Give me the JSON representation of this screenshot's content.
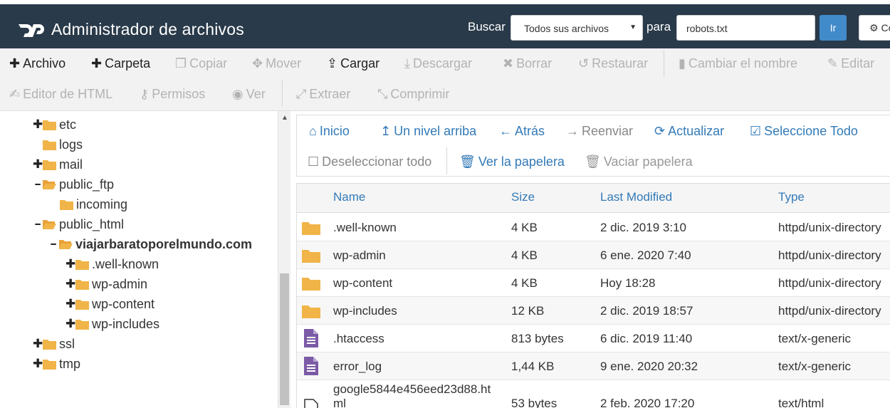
{
  "header": {
    "app_title": "Administrador de archivos",
    "search_label": "Buscar",
    "search_scope": "Todos sus archivos",
    "para_label": "para",
    "search_value": "robots.txt",
    "go_label": "Ir",
    "settings_label": "Co",
    "brand_color": "#293a4a"
  },
  "toolbar": {
    "row1": [
      {
        "label": "Archivo",
        "icon": "plus-icon",
        "enabled": true
      },
      {
        "label": "Carpeta",
        "icon": "plus-icon",
        "enabled": true
      },
      {
        "label": "Copiar",
        "icon": "copy-icon",
        "enabled": false
      },
      {
        "label": "Mover",
        "icon": "move-icon",
        "enabled": false
      },
      {
        "label": "Cargar",
        "icon": "upload-icon",
        "enabled": true
      },
      {
        "label": "Descargar",
        "icon": "download-icon",
        "enabled": false
      },
      {
        "label": "Borrar",
        "icon": "times-icon",
        "enabled": false
      },
      {
        "label": "Restaurar",
        "icon": "undo-icon",
        "enabled": false
      },
      {
        "label": "Cambiar el nombre",
        "icon": "file-icon",
        "enabled": false
      },
      {
        "label": "Editar",
        "icon": "pencil-icon",
        "enabled": false
      }
    ],
    "row2": [
      {
        "label": "Editor de HTML",
        "icon": "edit-icon",
        "enabled": false
      },
      {
        "label": "Permisos",
        "icon": "key-icon",
        "enabled": false
      },
      {
        "label": "Ver",
        "icon": "eye-icon",
        "enabled": false
      },
      {
        "label": "Extraer",
        "icon": "expand-icon",
        "enabled": false
      },
      {
        "label": "Comprimir",
        "icon": "compress-icon",
        "enabled": false
      }
    ]
  },
  "tree": {
    "nodes": [
      {
        "label": "etc",
        "toggle": "+"
      },
      {
        "label": "logs",
        "toggle": ""
      },
      {
        "label": "mail",
        "toggle": "+"
      },
      {
        "label": "public_ftp",
        "toggle": "−"
      },
      {
        "label": "incoming",
        "toggle": ""
      },
      {
        "label": "public_html",
        "toggle": "−"
      },
      {
        "label": "viajarbaratoporelmundo.com",
        "toggle": "−"
      },
      {
        "label": ".well-known",
        "toggle": "+"
      },
      {
        "label": "wp-admin",
        "toggle": "+"
      },
      {
        "label": "wp-content",
        "toggle": "+"
      },
      {
        "label": "wp-includes",
        "toggle": "+"
      },
      {
        "label": "ssl",
        "toggle": "+"
      },
      {
        "label": "tmp",
        "toggle": "+"
      }
    ]
  },
  "nav": {
    "home": "Inicio",
    "up": "Un nivel arriba",
    "back": "Atrás",
    "forward": "Reenviar",
    "reload": "Actualizar",
    "select_all": "Seleccione Todo",
    "unselect_all": "Deseleccionar todo",
    "view_trash": "Ver la papelera",
    "empty_trash": "Vaciar papelera"
  },
  "table": {
    "columns": [
      "Name",
      "Size",
      "Last Modified",
      "Type"
    ],
    "rows": [
      {
        "icon": "folder-icon",
        "name": ".well-known",
        "size": "4 KB",
        "modified": "2 dic. 2019 3:10",
        "type": "httpd/unix-directory"
      },
      {
        "icon": "folder-icon",
        "name": "wp-admin",
        "size": "4 KB",
        "modified": "6 ene. 2020 7:40",
        "type": "httpd/unix-directory"
      },
      {
        "icon": "folder-icon",
        "name": "wp-content",
        "size": "4 KB",
        "modified": "Hoy 18:28",
        "type": "httpd/unix-directory"
      },
      {
        "icon": "folder-icon",
        "name": "wp-includes",
        "size": "12 KB",
        "modified": "2 dic. 2019 18:57",
        "type": "httpd/unix-directory"
      },
      {
        "icon": "text-file-icon",
        "name": ".htaccess",
        "size": "813 bytes",
        "modified": "6 dic. 2019 11:40",
        "type": "text/x-generic"
      },
      {
        "icon": "text-file-icon",
        "name": "error_log",
        "size": "1,44 KB",
        "modified": "9 ene. 2020 20:32",
        "type": "text/x-generic"
      },
      {
        "icon": "html-file-icon",
        "name": "google5844e456eed23d88.html",
        "size": "53 bytes",
        "modified": "2 feb. 2020 17:20",
        "type": "text/html"
      }
    ]
  }
}
